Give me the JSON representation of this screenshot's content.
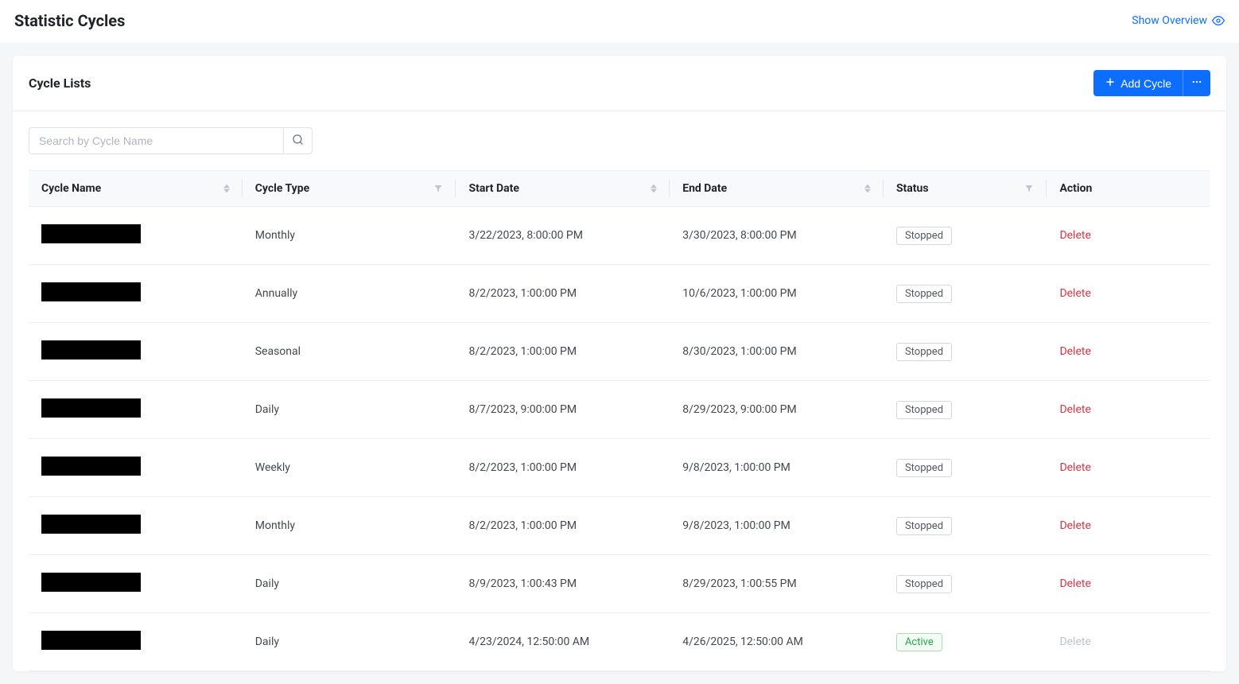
{
  "header": {
    "title": "Statistic Cycles",
    "overview_link": "Show Overview"
  },
  "panel": {
    "title": "Cycle Lists",
    "add_button": "Add Cycle"
  },
  "search": {
    "placeholder": "Search by Cycle Name",
    "value": ""
  },
  "columns": {
    "cycle_name": "Cycle Name",
    "cycle_type": "Cycle Type",
    "start_date": "Start Date",
    "end_date": "End Date",
    "status": "Status",
    "action": "Action"
  },
  "action_labels": {
    "delete": "Delete"
  },
  "rows": [
    {
      "name": "",
      "type": "Monthly",
      "start": "3/22/2023, 8:00:00 PM",
      "end": "3/30/2023, 8:00:00 PM",
      "status": "Stopped",
      "can_delete": true
    },
    {
      "name": "",
      "type": "Annually",
      "start": "8/2/2023, 1:00:00 PM",
      "end": "10/6/2023, 1:00:00 PM",
      "status": "Stopped",
      "can_delete": true
    },
    {
      "name": "",
      "type": "Seasonal",
      "start": "8/2/2023, 1:00:00 PM",
      "end": "8/30/2023, 1:00:00 PM",
      "status": "Stopped",
      "can_delete": true
    },
    {
      "name": "",
      "type": "Daily",
      "start": "8/7/2023, 9:00:00 PM",
      "end": "8/29/2023, 9:00:00 PM",
      "status": "Stopped",
      "can_delete": true
    },
    {
      "name": "",
      "type": "Weekly",
      "start": "8/2/2023, 1:00:00 PM",
      "end": "9/8/2023, 1:00:00 PM",
      "status": "Stopped",
      "can_delete": true
    },
    {
      "name": "",
      "type": "Monthly",
      "start": "8/2/2023, 1:00:00 PM",
      "end": "9/8/2023, 1:00:00 PM",
      "status": "Stopped",
      "can_delete": true
    },
    {
      "name": "",
      "type": "Daily",
      "start": "8/9/2023, 1:00:43 PM",
      "end": "8/29/2023, 1:00:55 PM",
      "status": "Stopped",
      "can_delete": true
    },
    {
      "name": "",
      "type": "Daily",
      "start": "4/23/2024, 12:50:00 AM",
      "end": "4/26/2025, 12:50:00 AM",
      "status": "Active",
      "can_delete": false
    }
  ]
}
